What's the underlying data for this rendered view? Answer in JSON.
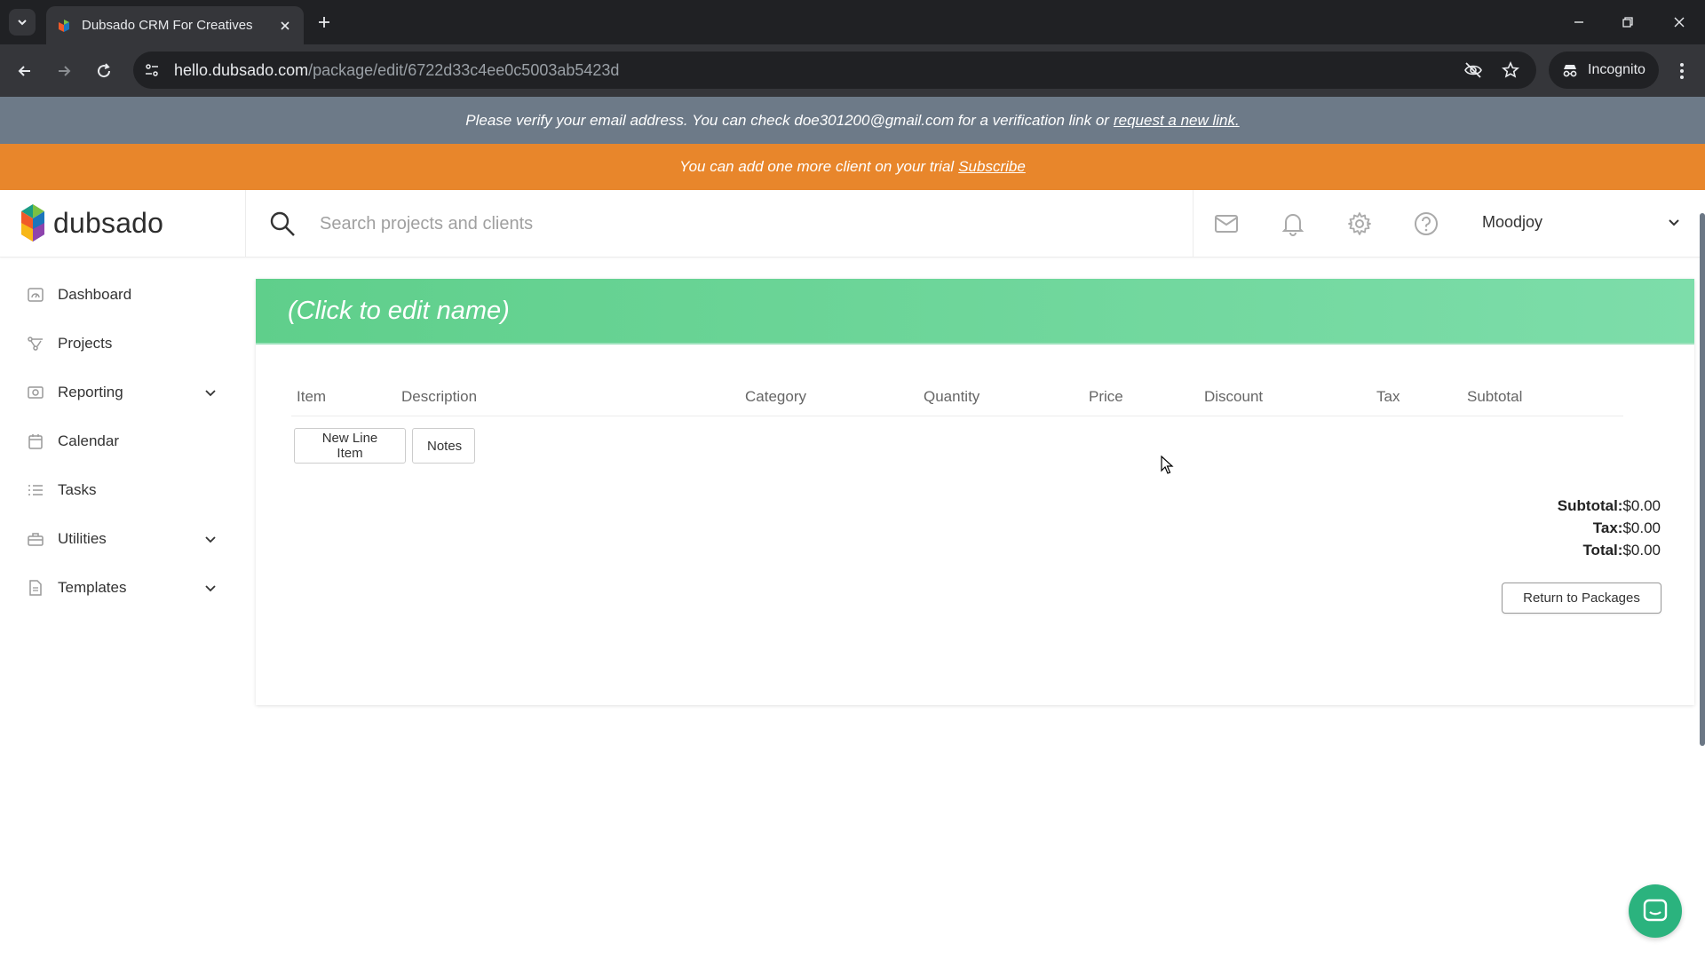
{
  "browser": {
    "tab_title": "Dubsado CRM For Creatives",
    "url_host": "hello.dubsado.com",
    "url_path": "/package/edit/6722d33c4ee0c5003ab5423d",
    "incognito_label": "Incognito"
  },
  "banners": {
    "verify_text": "Please verify your email address. You can check doe301200@gmail.com for a verification link or",
    "verify_link": "request a new link.",
    "trial_text": "You can add one more client on your trial",
    "trial_link": "Subscribe"
  },
  "header": {
    "logo_text": "dubsado",
    "search_placeholder": "Search projects and clients",
    "user_name": "Moodjoy"
  },
  "sidebar": {
    "items": [
      {
        "label": "Dashboard",
        "icon": "dashboard-icon",
        "has_caret": false
      },
      {
        "label": "Projects",
        "icon": "projects-icon",
        "has_caret": false
      },
      {
        "label": "Reporting",
        "icon": "reporting-icon",
        "has_caret": true
      },
      {
        "label": "Calendar",
        "icon": "calendar-icon",
        "has_caret": false
      },
      {
        "label": "Tasks",
        "icon": "tasks-icon",
        "has_caret": false
      },
      {
        "label": "Utilities",
        "icon": "utilities-icon",
        "has_caret": true
      },
      {
        "label": "Templates",
        "icon": "templates-icon",
        "has_caret": true
      }
    ]
  },
  "package": {
    "name_placeholder": "(Click to edit name)",
    "columns": [
      "Item",
      "Description",
      "Category",
      "Quantity",
      "Price",
      "Discount",
      "Tax",
      "Subtotal"
    ],
    "new_line_item_label": "New Line Item",
    "notes_label": "Notes",
    "totals": {
      "subtotal_label": "Subtotal:",
      "subtotal_value": "$0.00",
      "tax_label": "Tax:",
      "tax_value": "$0.00",
      "total_label": "Total:",
      "total_value": "$0.00"
    },
    "return_label": "Return to Packages"
  },
  "colors": {
    "verify_banner": "#6d7a88",
    "trial_banner": "#e8862b",
    "card_header": "#5fcf8b",
    "chat_bubble": "#2bb37e"
  }
}
